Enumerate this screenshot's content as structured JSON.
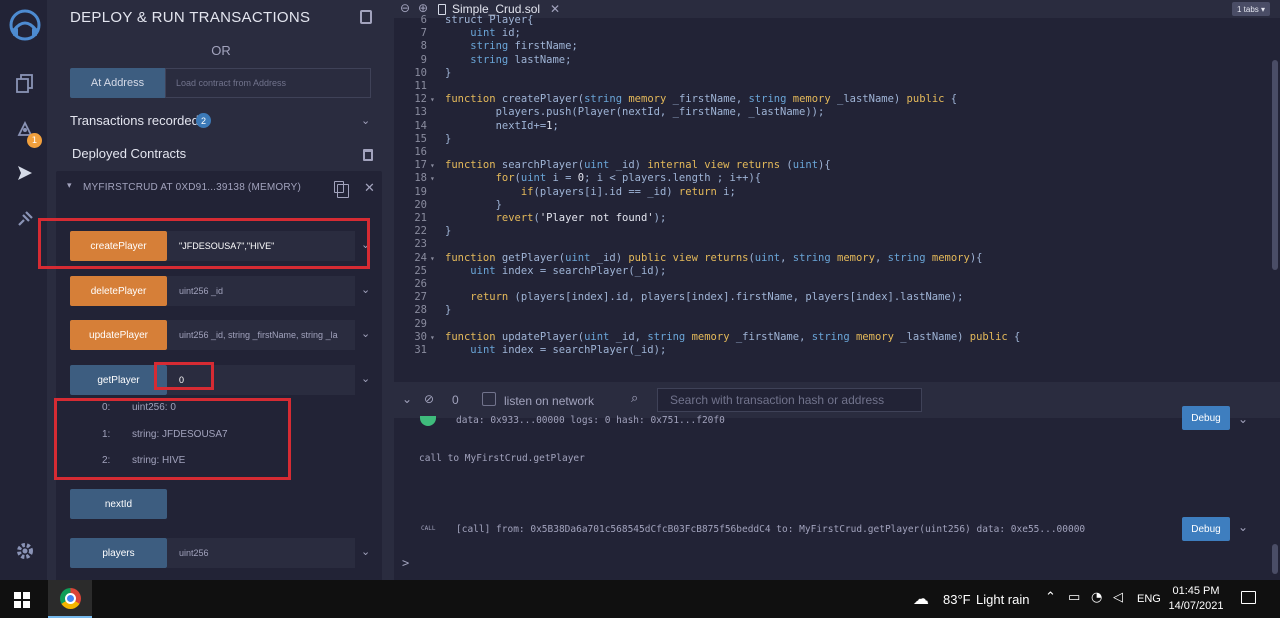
{
  "panel": {
    "title": "DEPLOY & RUN TRANSACTIONS",
    "or": "OR",
    "at_address_label": "At Address",
    "at_address_placeholder": "Load contract from Address",
    "transactions_recorded": "Transactions recorded",
    "transactions_count": "2",
    "deployed_contracts": "Deployed Contracts",
    "contract_title": "MYFIRSTCRUD AT 0XD91...39138 (MEMORY)",
    "functions": [
      {
        "label": "createPlayer",
        "kind": "transact",
        "value": "\"JFDESOUSA7\",\"HIVE\"",
        "placeholder": ""
      },
      {
        "label": "deletePlayer",
        "kind": "transact",
        "value": "",
        "placeholder": "uint256 _id"
      },
      {
        "label": "updatePlayer",
        "kind": "transact",
        "value": "",
        "placeholder": "uint256 _id, string _firstName, string _la"
      },
      {
        "label": "getPlayer",
        "kind": "call",
        "value": "0",
        "placeholder": ""
      },
      {
        "label": "nextId",
        "kind": "call",
        "value": "",
        "placeholder": ""
      },
      {
        "label": "players",
        "kind": "call",
        "value": "",
        "placeholder": "uint256"
      }
    ],
    "results": [
      {
        "index": "0:",
        "value": "uint256: 0"
      },
      {
        "index": "1:",
        "value": "string: JFDESOUSA7"
      },
      {
        "index": "2:",
        "value": "string: HIVE"
      }
    ]
  },
  "sidebar_badge": "1",
  "editor": {
    "file_name": "Simple_Crud.sol",
    "tabs_pill": "1 tabs",
    "lines": [
      {
        "n": "6",
        "fold": "",
        "html": "struct Player{"
      },
      {
        "n": "7",
        "fold": "",
        "html": "    <span class=\"ty\">uint</span> id;"
      },
      {
        "n": "8",
        "fold": "",
        "html": "    <span class=\"ty\">string</span> firstName;"
      },
      {
        "n": "9",
        "fold": "",
        "html": "    <span class=\"ty\">string</span> lastName;"
      },
      {
        "n": "10",
        "fold": "",
        "html": "}"
      },
      {
        "n": "11",
        "fold": "",
        "html": ""
      },
      {
        "n": "12",
        "fold": "▾",
        "html": "<span class=\"kw\">function</span> createPlayer(<span class=\"ty\">string</span> <span class=\"kw\">memory</span> _firstName, <span class=\"ty\">string</span> <span class=\"kw\">memory</span> _lastName) <span class=\"kw\">public</span> {"
      },
      {
        "n": "13",
        "fold": "",
        "html": "        players.push(Player(nextId, _firstName, _lastName));"
      },
      {
        "n": "14",
        "fold": "",
        "html": "        nextId+=<span class=\"str\">1</span>;"
      },
      {
        "n": "15",
        "fold": "",
        "html": "}"
      },
      {
        "n": "16",
        "fold": "",
        "html": ""
      },
      {
        "n": "17",
        "fold": "▾",
        "html": "<span class=\"kw\">function</span> searchPlayer(<span class=\"ty\">uint</span> _id) <span class=\"kw\">internal view returns</span> (<span class=\"ty\">uint</span>){"
      },
      {
        "n": "18",
        "fold": "▾",
        "html": "        <span class=\"kw\">for</span>(<span class=\"ty\">uint</span> i = <span class=\"str\">0</span>; i < players.length ; i++){"
      },
      {
        "n": "19",
        "fold": "",
        "html": "            <span class=\"kw\">if</span>(players[i].id == _id) <span class=\"kw\">return</span> i;"
      },
      {
        "n": "20",
        "fold": "",
        "html": "        }"
      },
      {
        "n": "21",
        "fold": "",
        "html": "        <span class=\"kw\">revert</span>(<span class=\"str\">'Player not found'</span>);"
      },
      {
        "n": "22",
        "fold": "",
        "html": "}"
      },
      {
        "n": "23",
        "fold": "",
        "html": ""
      },
      {
        "n": "24",
        "fold": "▾",
        "html": "<span class=\"kw\">function</span> getPlayer(<span class=\"ty\">uint</span> _id) <span class=\"kw\">public view returns</span>(<span class=\"ty\">uint</span>, <span class=\"ty\">string</span> <span class=\"kw\">memory</span>, <span class=\"ty\">string</span> <span class=\"kw\">memory</span>){"
      },
      {
        "n": "25",
        "fold": "",
        "html": "    <span class=\"ty\">uint</span> index = searchPlayer(_id);"
      },
      {
        "n": "26",
        "fold": "",
        "html": ""
      },
      {
        "n": "27",
        "fold": "",
        "html": "    <span class=\"kw\">return</span> (players[index].id, players[index].firstName, players[index].lastName);"
      },
      {
        "n": "28",
        "fold": "",
        "html": "}"
      },
      {
        "n": "29",
        "fold": "",
        "html": ""
      },
      {
        "n": "30",
        "fold": "▾",
        "html": "<span class=\"kw\">function</span> updatePlayer(<span class=\"ty\">uint</span> _id, <span class=\"ty\">string</span> <span class=\"kw\">memory</span> _firstName, <span class=\"ty\">string</span> <span class=\"kw\">memory</span> _lastName) <span class=\"kw\">public</span> {"
      },
      {
        "n": "31",
        "fold": "",
        "html": "    <span class=\"ty\">uint</span> index = searchPlayer(_id);"
      }
    ]
  },
  "terminal": {
    "count": "0",
    "listen_label": "listen on network",
    "search_placeholder": "Search with transaction hash or address",
    "line1": "data: 0x933...00000 logs: 0 hash: 0x751...f20f0",
    "line2": "call to MyFirstCrud.getPlayer",
    "call_tag": "CALL",
    "line3": "[call]  from: 0x5B38Da6a701c568545dCfcB03FcB875f56beddC4 to: MyFirstCrud.getPlayer(uint256) data: 0xe55...00000",
    "debug_label": "Debug",
    "prompt": ">"
  },
  "taskbar": {
    "weather_temp": "83°F",
    "weather_text": "Light rain",
    "lang": "ENG",
    "time": "01:45 PM",
    "date": "14/07/2021"
  },
  "colors": {
    "transact_button": "#d67f38",
    "call_button": "#3d5d80",
    "highlight_box": "#d62b33",
    "debug_button": "#3e7ebf"
  }
}
